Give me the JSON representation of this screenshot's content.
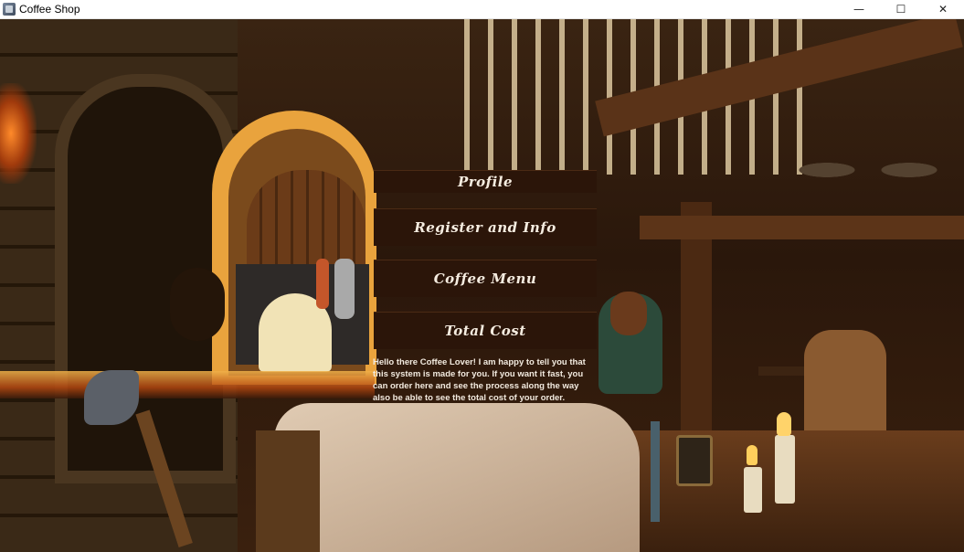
{
  "window": {
    "title": "Coffee Shop",
    "controls": {
      "minimize": "—",
      "maximize": "☐",
      "close": "✕"
    }
  },
  "menu": {
    "profile": "Profile",
    "register": "Register and Info",
    "coffee_menu": "Coffee Menu",
    "total_cost": "Total Cost"
  },
  "intro_text": "Hello there Coffee Lover! I am happy to tell you that this system is made for you. If you want it fast, you can order here and see the process along the way also be able to see the total cost of your order.",
  "colors": {
    "button_bg": "#2b1509",
    "button_text": "#f5ece0",
    "scene_dark": "#2a170b"
  },
  "background_scene": "pixel-art-medieval-tavern"
}
